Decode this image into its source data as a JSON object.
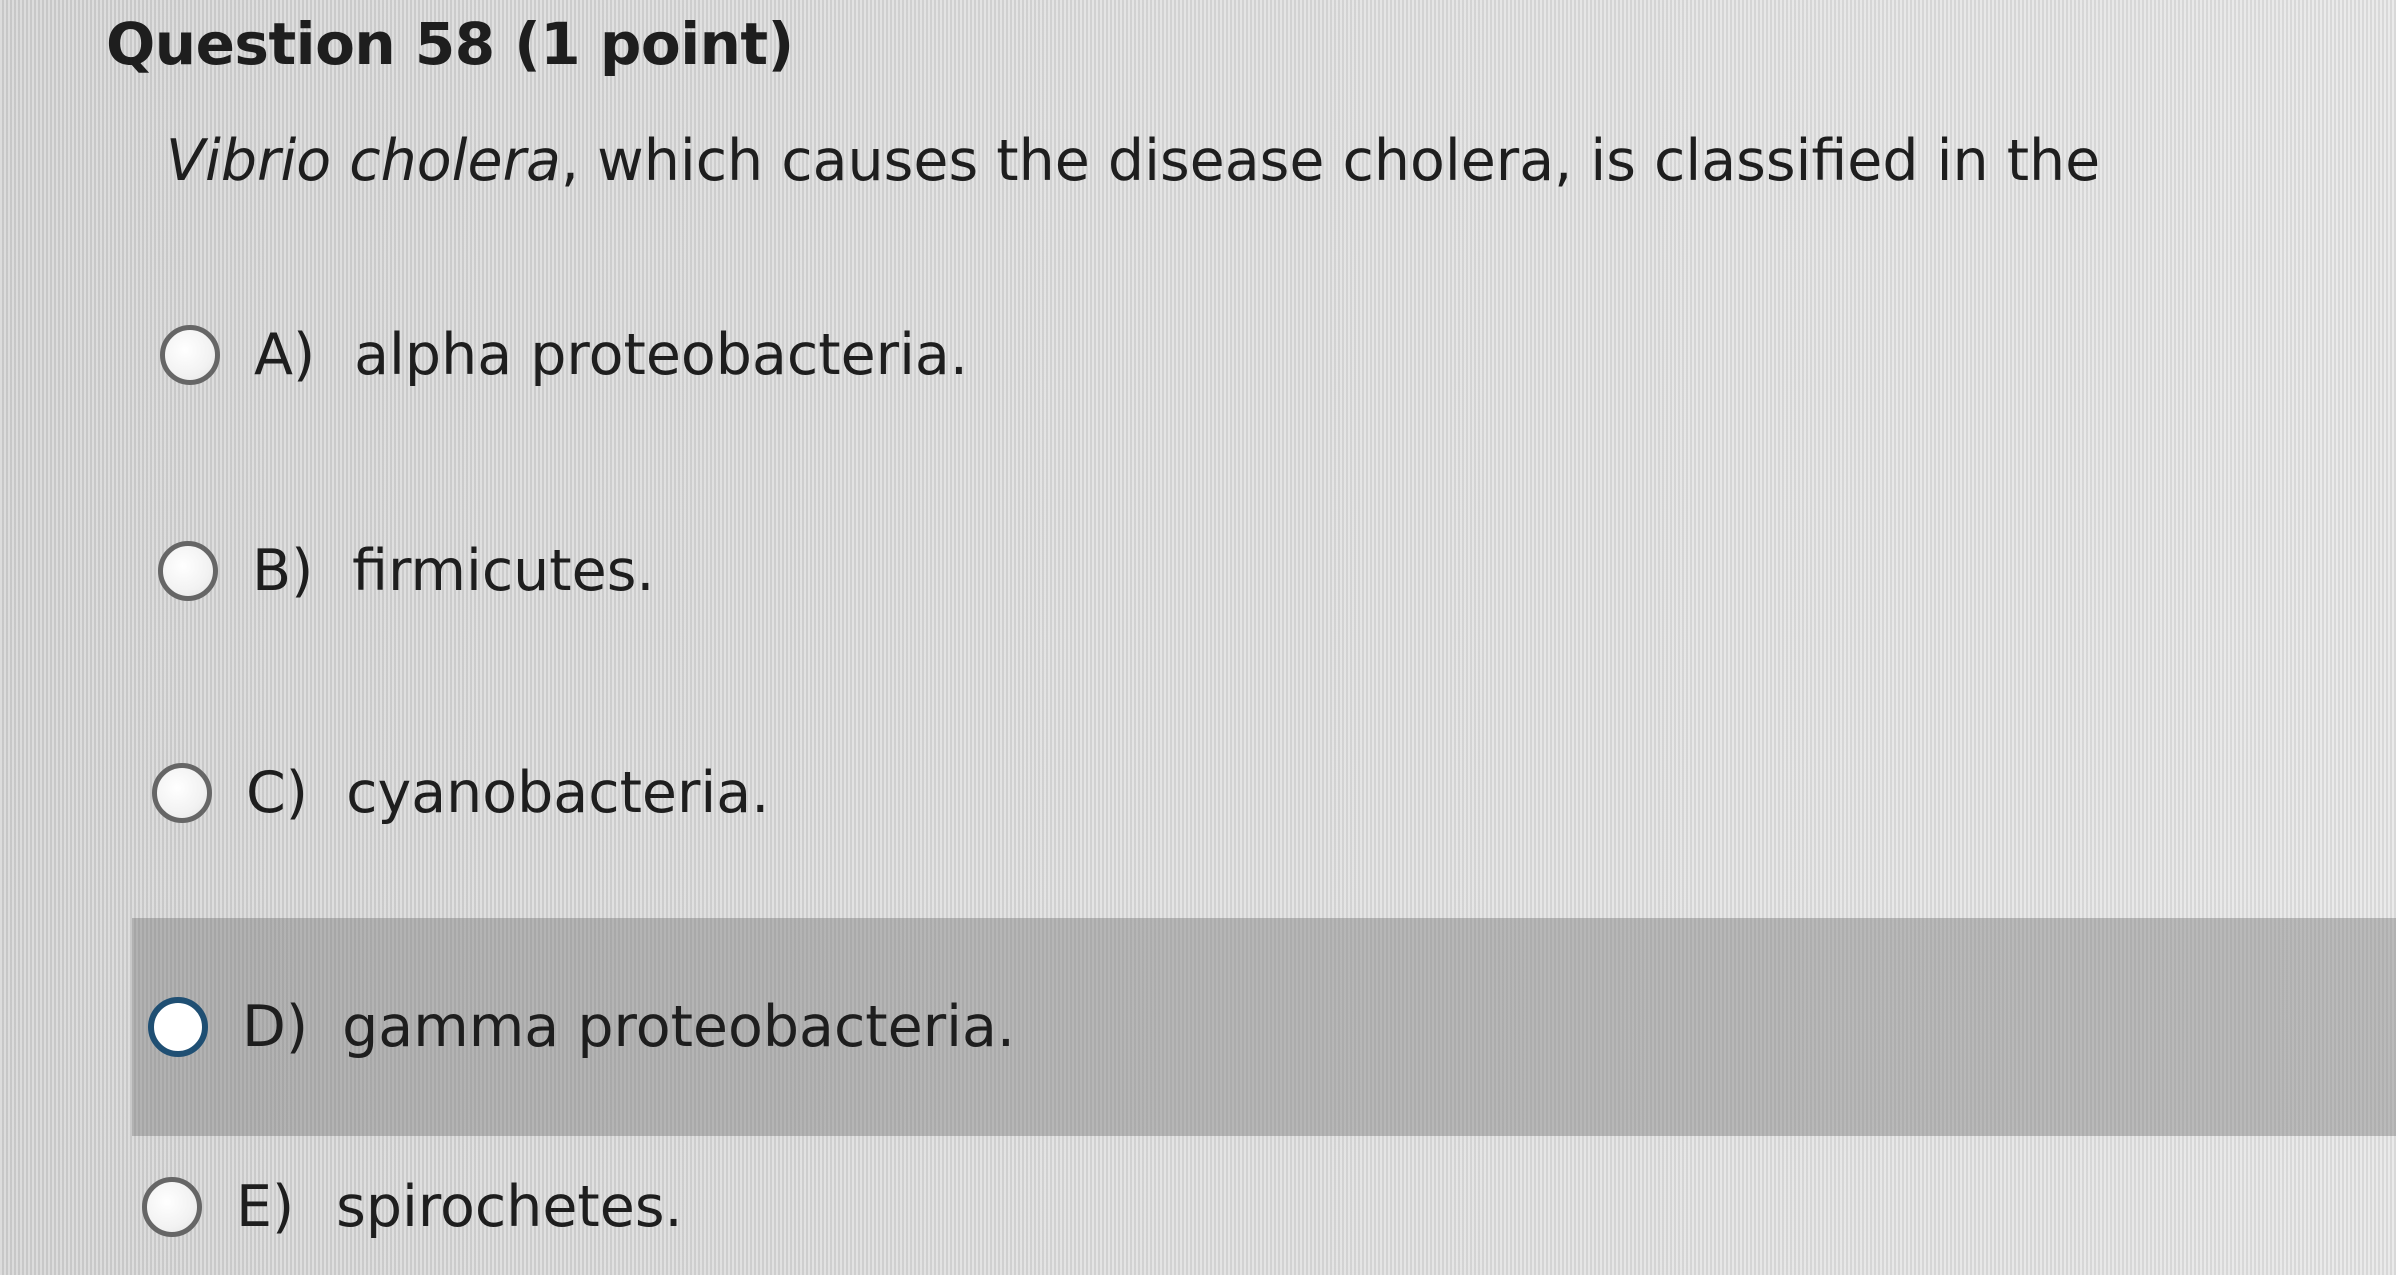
{
  "question": {
    "title": "Question 58 (1 point)",
    "stem_species": "Vibrio cholera",
    "stem_rest": ", which causes the disease cholera, is classified in the"
  },
  "options": [
    {
      "letter": "A)",
      "text": "alpha proteobacteria.",
      "selected": false
    },
    {
      "letter": "B)",
      "text": "firmicutes.",
      "selected": false
    },
    {
      "letter": "C)",
      "text": "cyanobacteria.",
      "selected": false
    },
    {
      "letter": "D)",
      "text": "gamma proteobacteria.",
      "selected": true
    },
    {
      "letter": "E)",
      "text": "spirochetes.",
      "selected": false
    }
  ],
  "colors": {
    "selected_row": "#8c8c8c",
    "selected_radio_border": "#1f4f73",
    "text": "#1e1e1e"
  }
}
